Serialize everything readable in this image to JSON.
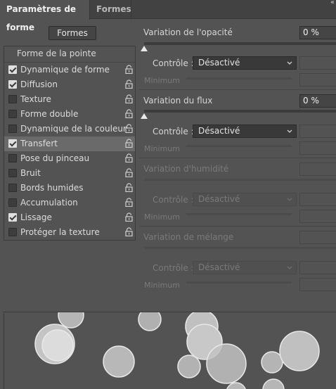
{
  "tabs": {
    "active": "Paramètres de forme",
    "inactive": "Formes"
  },
  "formes_button": "Formes",
  "list": {
    "header": "Forme de la pointe",
    "items": [
      {
        "label": "Dynamique de forme",
        "checked": true
      },
      {
        "label": "Diffusion",
        "checked": true
      },
      {
        "label": "Texture",
        "checked": false
      },
      {
        "label": "Forme double",
        "checked": false
      },
      {
        "label": "Dynamique de la couleur",
        "checked": false
      },
      {
        "label": "Transfert",
        "checked": true,
        "selected": true
      },
      {
        "label": "Pose du pinceau",
        "checked": false
      },
      {
        "label": "Bruit",
        "checked": false
      },
      {
        "label": "Bords humides",
        "checked": false
      },
      {
        "label": "Accumulation",
        "checked": false
      },
      {
        "label": "Lissage",
        "checked": true
      },
      {
        "label": "Protéger la texture",
        "checked": false
      }
    ]
  },
  "opacity": {
    "label": "Variation de l'opacité",
    "value": "0 %",
    "control_label": "Contrôle :",
    "control_value": "Désactivé",
    "minimum_label": "Minimum"
  },
  "flow": {
    "label": "Variation du flux",
    "value": "0 %",
    "control_label": "Contrôle :",
    "control_value": "Désactivé",
    "minimum_label": "Minimum"
  },
  "wetness": {
    "label": "Variation d'humidité",
    "control_label": "Contrôle :",
    "control_value": "Désactivé",
    "minimum_label": "Minimum"
  },
  "mix": {
    "label": "Variation de mélange",
    "control_label": "Contrôle :",
    "control_value": "Désactivé",
    "minimum_label": "Minimum"
  },
  "colors": {
    "panel_bg": "#535353",
    "tabbar_bg": "#424242",
    "selected_row": "#6a6a6a",
    "text": "#d6d6d6",
    "disabled_text": "#7a7a7a"
  }
}
